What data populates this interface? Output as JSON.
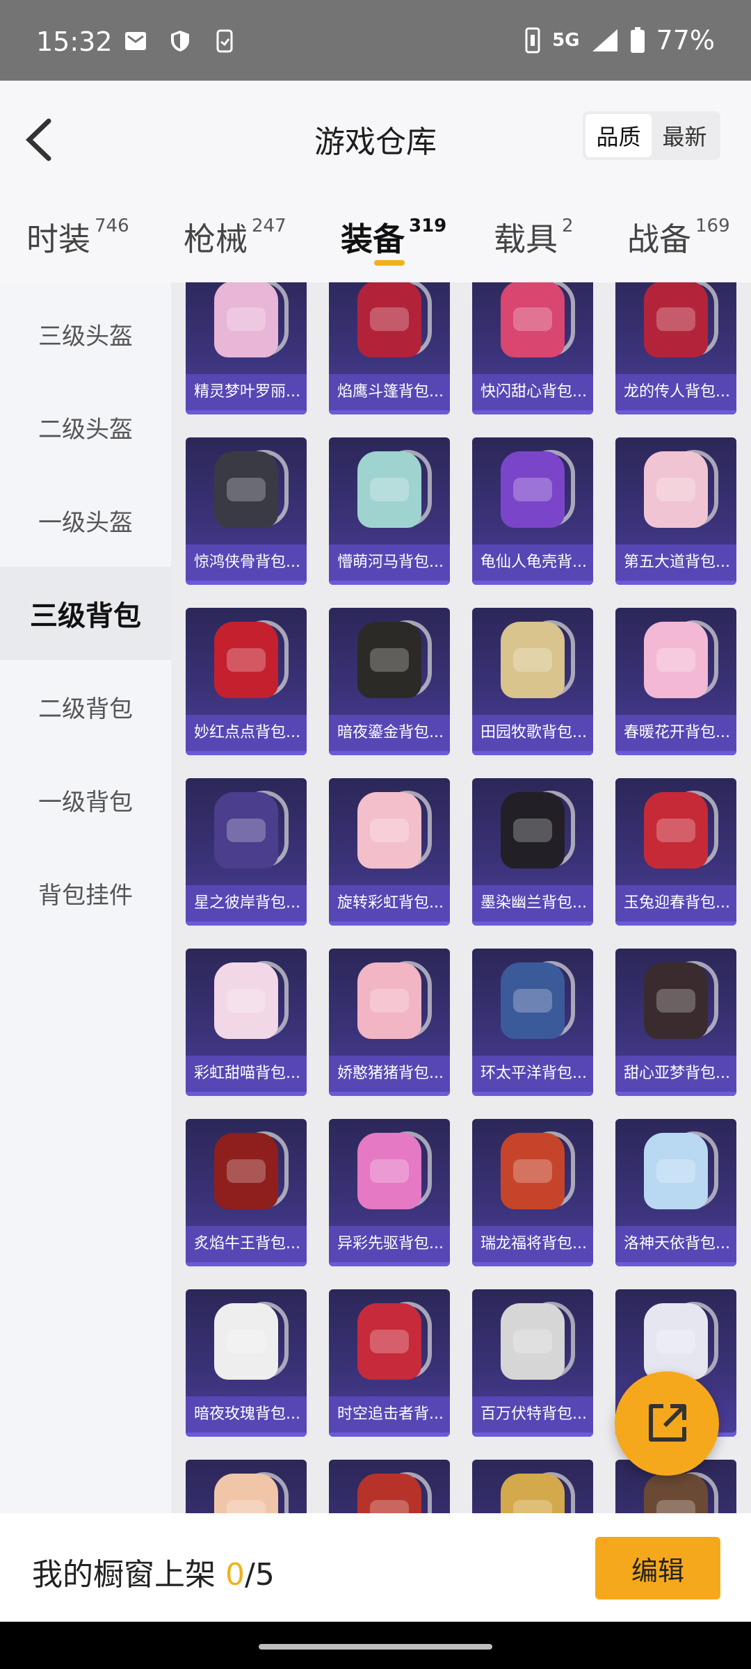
{
  "status": {
    "time": "15:32",
    "network": "5G",
    "battery": "77%",
    "icons": [
      "mail-icon",
      "shield-icon",
      "phone-sync-icon"
    ]
  },
  "header": {
    "title": "游戏仓库",
    "sort": [
      "品质",
      "最新"
    ],
    "sort_active": "品质"
  },
  "tabs": [
    {
      "label": "时装",
      "count": "746"
    },
    {
      "label": "枪械",
      "count": "247"
    },
    {
      "label": "装备",
      "count": "319",
      "active": true
    },
    {
      "label": "载具",
      "count": "2"
    },
    {
      "label": "战备",
      "count": "169"
    }
  ],
  "sidebar": [
    {
      "label": "三级头盔"
    },
    {
      "label": "二级头盔"
    },
    {
      "label": "一级头盔"
    },
    {
      "label": "三级背包",
      "active": true
    },
    {
      "label": "二级背包"
    },
    {
      "label": "一级背包"
    },
    {
      "label": "背包挂件"
    }
  ],
  "items": [
    {
      "name": "精灵梦叶罗丽...",
      "color": "#e8b6d6"
    },
    {
      "name": "焰鹰斗篷背包...",
      "color": "#b2233a"
    },
    {
      "name": "快闪甜心背包...",
      "color": "#d9466f"
    },
    {
      "name": "龙的传人背包...",
      "color": "#b3243a"
    },
    {
      "name": "惊鸿侠骨背包...",
      "color": "#3a3a44"
    },
    {
      "name": "懵萌河马背包...",
      "color": "#9fd3d0"
    },
    {
      "name": "龟仙人龟壳背...",
      "color": "#7b45c9"
    },
    {
      "name": "第五大道背包...",
      "color": "#f0c4d2"
    },
    {
      "name": "妙红点点背包...",
      "color": "#c4202e"
    },
    {
      "name": "暗夜鎏金背包...",
      "color": "#2c2a26"
    },
    {
      "name": "田园牧歌背包...",
      "color": "#d8c48c"
    },
    {
      "name": "春暖花开背包...",
      "color": "#f3b8d4"
    },
    {
      "name": "星之彼岸背包...",
      "color": "#4b3e8c"
    },
    {
      "name": "旋转彩虹背包...",
      "color": "#f3bfcb"
    },
    {
      "name": "墨染幽兰背包...",
      "color": "#222026"
    },
    {
      "name": "玉兔迎春背包...",
      "color": "#c62a36"
    },
    {
      "name": "彩虹甜喵背包...",
      "color": "#f2d7e6"
    },
    {
      "name": "娇憨猪猪背包...",
      "color": "#f2b5c4"
    },
    {
      "name": "环太平洋背包...",
      "color": "#3b5a9a"
    },
    {
      "name": "甜心亚梦背包...",
      "color": "#3a2c2e"
    },
    {
      "name": "炙焰牛王背包...",
      "color": "#8e1f1d"
    },
    {
      "name": "异彩先驱背包...",
      "color": "#e579c4"
    },
    {
      "name": "瑞龙福将背包...",
      "color": "#c6452a"
    },
    {
      "name": "洛神天依背包...",
      "color": "#b9d8f2"
    },
    {
      "name": "暗夜玫瑰背包...",
      "color": "#eeeeee"
    },
    {
      "name": "时空追击者背...",
      "color": "#c72a3a"
    },
    {
      "name": "百万伏特背包...",
      "color": "#d6d6d6"
    },
    {
      "name": "",
      "color": "#e6e6f0"
    },
    {
      "name": "",
      "color": "#f1c6a8"
    },
    {
      "name": "",
      "color": "#b7332a"
    },
    {
      "name": "",
      "color": "#d4a94b"
    },
    {
      "name": "",
      "color": "#6b4a35"
    }
  ],
  "bottom": {
    "shelf_label": "我的橱窗上架 ",
    "shelf_count": "0",
    "shelf_total": "/5",
    "edit_label": "编辑"
  }
}
